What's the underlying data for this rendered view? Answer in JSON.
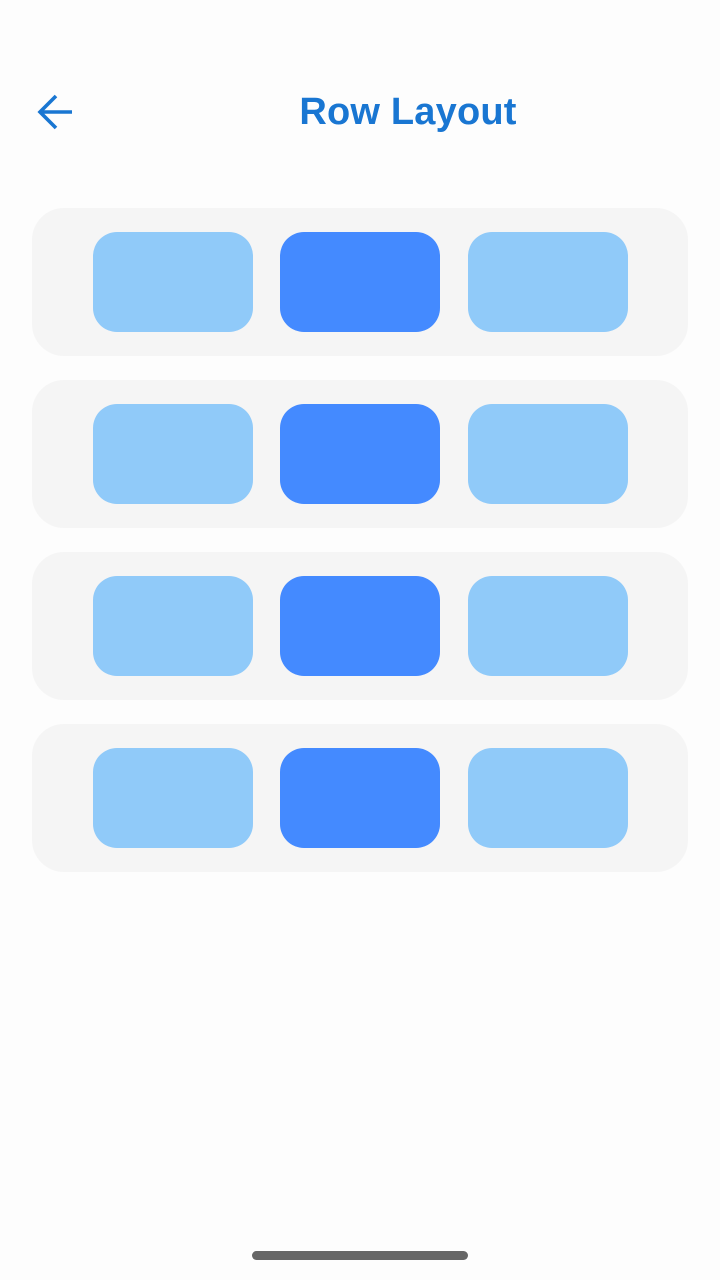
{
  "app_bar": {
    "title": "Row Layout",
    "back_icon": "arrow-left-icon"
  },
  "colors": {
    "accent": "#1976d2",
    "card_background": "#f5f5f5",
    "item_light": "#90caf9",
    "item_dark": "#448aff",
    "home_indicator": "#666666"
  },
  "rows": [
    {
      "items": [
        "light",
        "dark",
        "light"
      ]
    },
    {
      "items": [
        "light",
        "dark",
        "light"
      ]
    },
    {
      "items": [
        "light",
        "dark",
        "light"
      ]
    },
    {
      "items": [
        "light",
        "dark",
        "light"
      ]
    }
  ]
}
